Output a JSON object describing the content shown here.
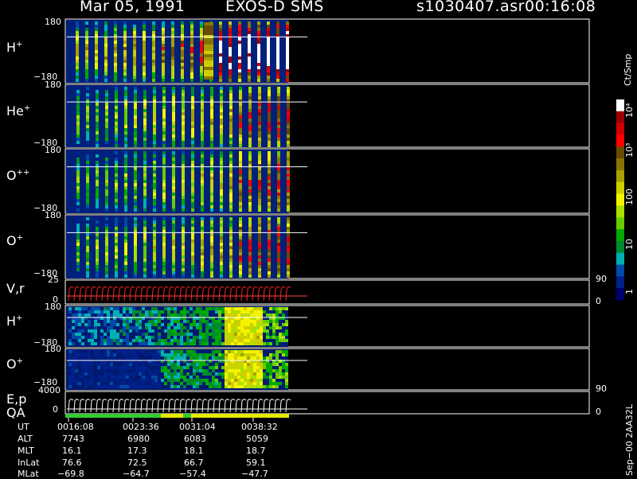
{
  "header": {
    "date": "Mar 05, 1991",
    "mission": "EXOS-D SMS",
    "file": "s1030407.asr",
    "time": "00:16:08"
  },
  "colorbar": {
    "unit": "Ct/Smp",
    "ticks": [
      "10⁴",
      "10³",
      "100",
      "10",
      "1"
    ],
    "colors": [
      "#ffffff",
      "#a00000",
      "#d00000",
      "#ff0000",
      "#6a4a00",
      "#8a7400",
      "#a8a000",
      "#cfcf00",
      "#f4f400",
      "#a8e000",
      "#66cc00",
      "#00aa00",
      "#008a30",
      "#00b0b0",
      "#004aa8",
      "#00208a",
      "#000070"
    ]
  },
  "panels": [
    {
      "id": "h-plus",
      "name": "H",
      "sup": "+",
      "top": "180",
      "bottom": "−180"
    },
    {
      "id": "he-plus",
      "name": "He",
      "sup": "+",
      "top": "180",
      "bottom": "−180"
    },
    {
      "id": "o-plusplus",
      "name": "O",
      "sup": "++",
      "top": "180",
      "bottom": "−180"
    },
    {
      "id": "o-plus",
      "name": "O",
      "sup": "+",
      "top": "180",
      "bottom": "−180"
    }
  ],
  "vr_panel": {
    "label": "V,r",
    "top": "25",
    "bottom": "0",
    "right_top": "90",
    "right_bottom": "0"
  },
  "lower_panels": [
    {
      "id": "h-plus-2",
      "name": "H",
      "sup": "+",
      "top": "180",
      "bottom": "−180"
    },
    {
      "id": "o-plus-2",
      "name": "O",
      "sup": "+",
      "top": "180",
      "bottom": "−180"
    }
  ],
  "ep_panel": {
    "label": "E,p",
    "label2": "QA",
    "top": "4000",
    "bottom": "0",
    "right_top": "90",
    "right_bottom": "0"
  },
  "ephemeris": {
    "labels": [
      "UT",
      "ALT",
      "MLT",
      "InLat",
      "MLat"
    ],
    "columns": [
      [
        "0016:08",
        "7743",
        "16.1",
        "76.6",
        "−69.8"
      ],
      [
        "0023:36",
        "6980",
        "17.3",
        "72.5",
        "−64.7"
      ],
      [
        "0031:04",
        "6083",
        "18.1",
        "66.7",
        "−57.4"
      ],
      [
        "0038:32",
        "5059",
        "18.7",
        "59.1",
        "−47.7"
      ]
    ]
  },
  "footer": {
    "version": "Sep−00 2AA32L"
  },
  "chart_data": {
    "type": "heatmap",
    "title": "Mar 05, 1991   EXOS-D SMS",
    "x": [
      "0016:08",
      "0023:36",
      "0031:04",
      "0038:32"
    ],
    "series": [
      {
        "name": "H+",
        "ylim": [
          -180,
          180
        ]
      },
      {
        "name": "He+",
        "ylim": [
          -180,
          180
        ]
      },
      {
        "name": "O++",
        "ylim": [
          -180,
          180
        ]
      },
      {
        "name": "O+",
        "ylim": [
          -180,
          180
        ]
      },
      {
        "name": "V,r",
        "ylim": [
          0,
          25
        ]
      },
      {
        "name": "H+",
        "ylim": [
          -180,
          180
        ]
      },
      {
        "name": "O+",
        "ylim": [
          -180,
          180
        ]
      },
      {
        "name": "E,p",
        "ylim": [
          0,
          4000
        ]
      }
    ],
    "zlabel": "Ct/Smp",
    "zscale": "log",
    "zlim": [
      1,
      10000
    ]
  }
}
